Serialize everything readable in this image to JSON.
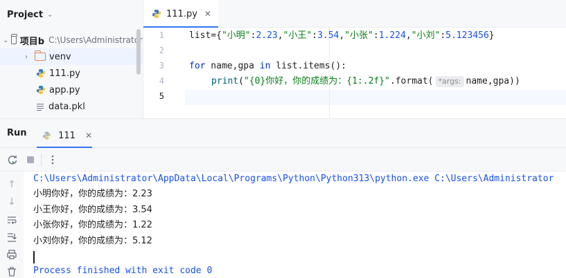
{
  "project_panel": {
    "title": "Project",
    "tree": [
      {
        "label": "项目b",
        "path": "C:\\Users\\Administrator"
      },
      {
        "label": "venv"
      },
      {
        "label": "111.py"
      },
      {
        "label": "app.py"
      },
      {
        "label": "data.pkl"
      }
    ]
  },
  "editor": {
    "tab_label": "111.py",
    "line_numbers": [
      "1",
      "2",
      "3",
      "4",
      "5"
    ],
    "code": {
      "line1": {
        "prefix": "list={",
        "k1": "\"小明\"",
        "v1": "2.23",
        "k2": "\"小王\"",
        "v2": "3.54",
        "k3": "\"小张\"",
        "v3": "1.224",
        "k4": "\"小刘\"",
        "v4": "5.123456",
        "suffix": "}"
      },
      "line3": {
        "kw_for": "for",
        "vars": " name,gpa ",
        "kw_in": "in",
        "rest": " list.items():"
      },
      "line4": {
        "fn": "print",
        "open": "(",
        "str": "\"{0}你好，你的成绩为：{1:.2f}\"",
        "method": ".format(",
        "hint": "*args:",
        "args": "name,gpa))"
      }
    }
  },
  "run_panel": {
    "title": "Run",
    "tab_label": "111",
    "console": {
      "command": "C:\\Users\\Administrator\\AppData\\Local\\Programs\\Python\\Python313\\python.exe C:\\Users\\Administrator",
      "outputs": [
        "小明你好，你的成绩为：2.23",
        "小王你好，你的成绩为：3.54",
        "小张你好，你的成绩为：1.22",
        "小刘你好，你的成绩为：5.12"
      ],
      "exit_message": "Process finished with exit code 0"
    }
  },
  "icons": [
    "chevron-down-icon",
    "chevron-right-icon",
    "folder-icon",
    "python-file-icon",
    "text-file-icon",
    "close-icon",
    "rerun-icon",
    "stop-icon",
    "more-icon",
    "arrow-up-icon",
    "arrow-down-icon",
    "soft-wrap-icon",
    "scroll-to-end-icon",
    "print-icon",
    "trash-icon"
  ],
  "colors": {
    "accent": "#3574f0",
    "keyword": "#0033b3",
    "string": "#067d17",
    "number": "#1750eb",
    "function": "#00627a"
  }
}
